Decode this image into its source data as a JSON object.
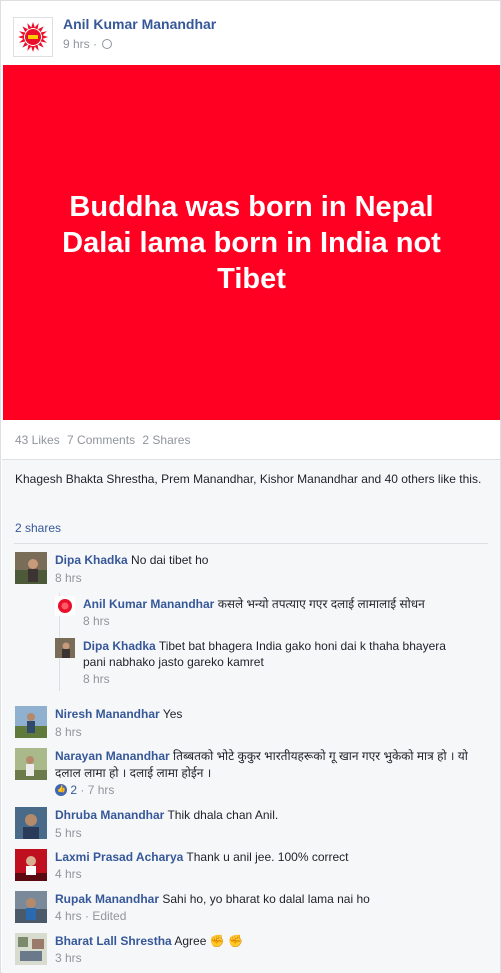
{
  "post": {
    "author": "Anil Kumar Manandhar",
    "time": "9 hrs",
    "separator": " · ",
    "banner_text": "Buddha was born in Nepal\nDalai lama born in India not\nTibet",
    "banner_color": "#ff0022"
  },
  "stats": {
    "likes": "43 Likes",
    "comments": "7 Comments",
    "shares": "2 Shares"
  },
  "likers": "Khagesh Bhakta Shrestha, Prem Manandhar, Kishor Manandhar and 40 others like this.",
  "shares_link": "2 shares",
  "comments": [
    {
      "name": "Dipa Khadka",
      "text": "No dai tibet ho",
      "time": "8 hrs"
    },
    {
      "name": "Anil Kumar Manandhar",
      "text": "कसले भन्यो तपत्याए गएर दलाई लामालाई सोधन",
      "time": "8 hrs"
    },
    {
      "name": "Dipa Khadka",
      "text": "Tibet bat bhagera India gako honi dai k thaha bhayera",
      "text2": "pani nabhako jasto gareko kamret",
      "time": "8 hrs"
    },
    {
      "name": "Niresh Manandhar",
      "text": "Yes",
      "time": "8 hrs"
    },
    {
      "name": "Narayan Manandhar",
      "text": "तिब्बतको भोटे कुकुर भारतीयहरूको गू खान गएर भुकेको मात्र हो । यो",
      "text2": "दलाल लामा हो । दलाई लामा होईन ।",
      "likes": "2",
      "time": "7 hrs"
    },
    {
      "name": "Dhruba Manandhar",
      "text": "Thik dhala chan Anil.",
      "time": "5 hrs"
    },
    {
      "name": "Laxmi Prasad Acharya",
      "text": "Thank u anil jee. 100% correct",
      "time": "4 hrs"
    },
    {
      "name": "Rupak Manandhar",
      "text": "Sahi ho, yo bharat ko dalal lama nai ho",
      "time": "4 hrs · Edited"
    },
    {
      "name": "Bharat Lall Shrestha",
      "text": "Agree ✊ ✊",
      "time": "3 hrs"
    }
  ]
}
